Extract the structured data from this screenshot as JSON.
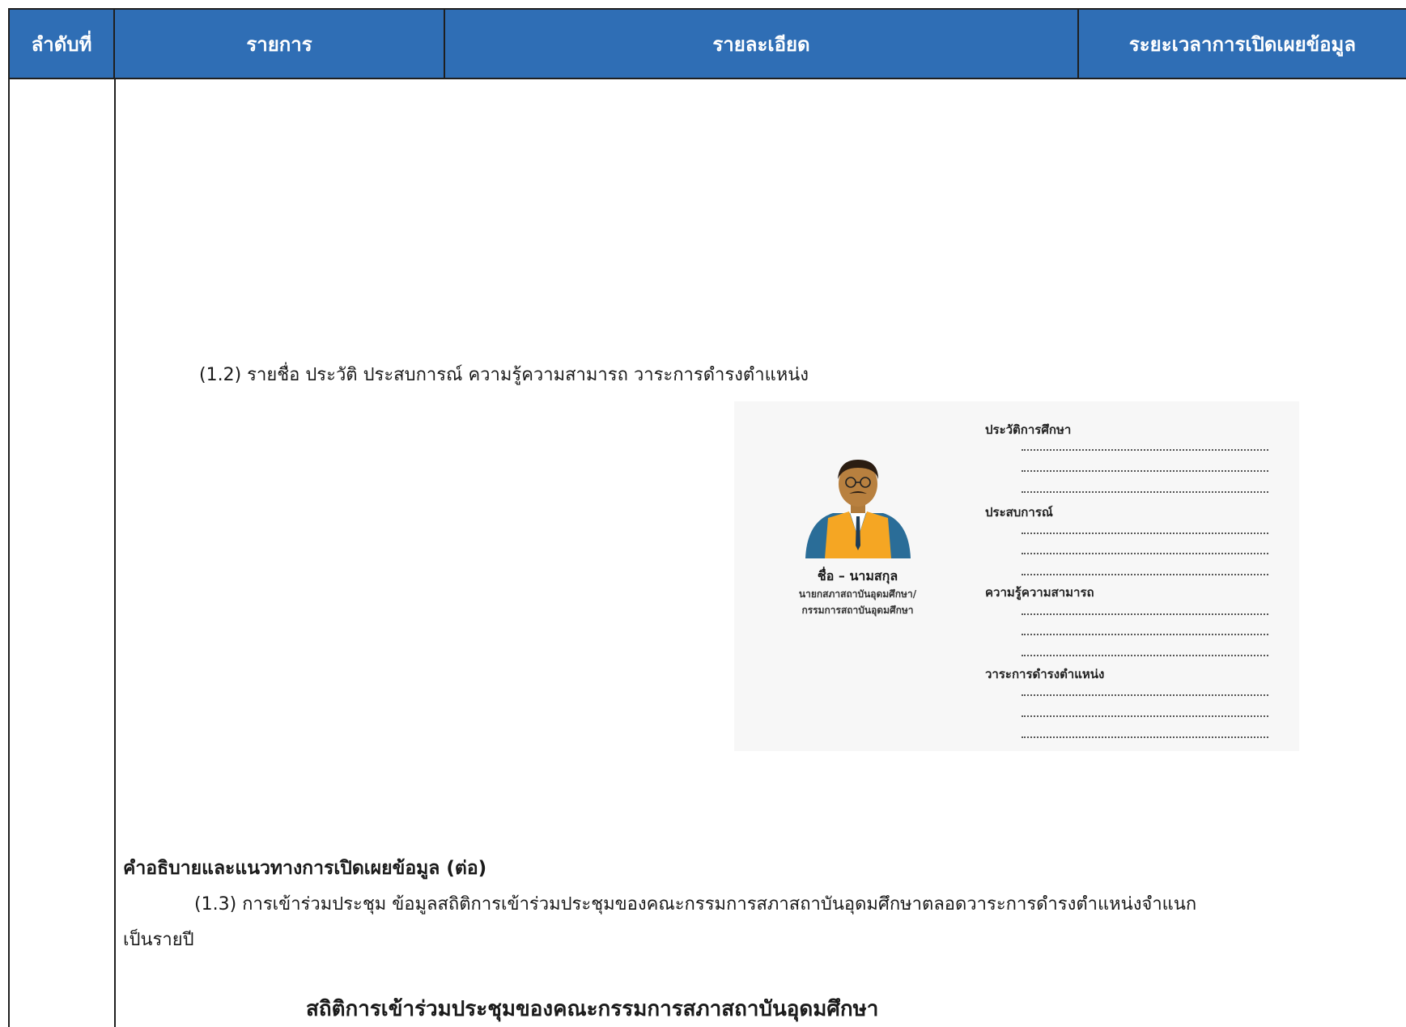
{
  "table": {
    "headers": [
      "ลำดับที่",
      "รายการ",
      "รายละเอียด",
      "ระยะเวลาการเปิดเผยข้อมูล"
    ]
  },
  "content": {
    "item_1_2": "(1.2) รายชื่อ ประวัติ ประสบการณ์ ความรู้ความสามารถ วาระการดำรงตำแหน่ง",
    "heading": "คำอธิบายและแนวทางการเปิดเผยข้อมูล (ต่อ)",
    "item_1_3_line1": "(1.3) การเข้าร่วมประชุม ข้อมูลสถิติการเข้าร่วมประชุมของคณะกรรมการสภาสถาบันอุดมศึกษาตลอดวาระการดำรงตำแหน่งจำแนก",
    "item_1_3_line2": "เป็นรายปี",
    "stat_title": "สถิติการเข้าร่วมประชุมของคณะกรรมการสภาสถาบันอุดมศึกษา"
  },
  "profile_card": {
    "avatar_icon": "person-avatar-icon",
    "name": "ชื่อ – นามสกุล",
    "role_line1": "นายกสภาสถาบันอุดมศึกษา/",
    "role_line2": "กรรมการสถาบันอุดมศึกษา",
    "sections": [
      "ประวัติการศึกษา",
      "ประสบการณ์",
      "ความรู้ความสามารถ",
      "วาระการดำรงตำแหน่ง"
    ]
  },
  "colors": {
    "header_bg": "#2f6eb5",
    "vest": "#f5a623",
    "shirt": "#2a6d98"
  }
}
